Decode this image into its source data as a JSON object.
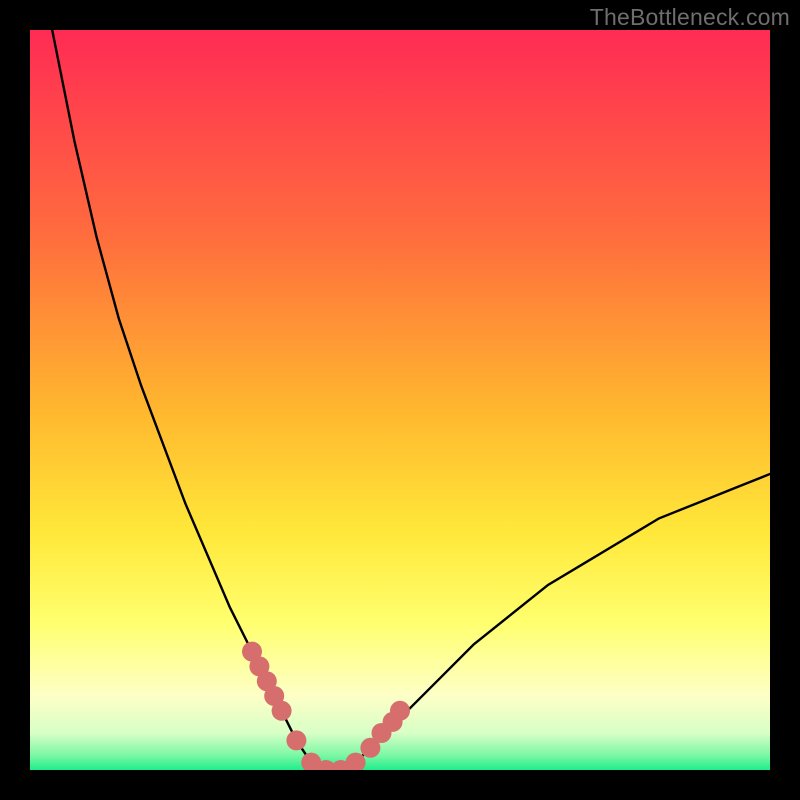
{
  "watermark": "TheBottleneck.com",
  "colors": {
    "frame": "#000000",
    "gradient_top": "#ff2b54",
    "gradient_mid1": "#ff7a3a",
    "gradient_mid2": "#ffd42a",
    "gradient_mid3": "#ffff6a",
    "gradient_mid4": "#fcffcd",
    "gradient_bottom": "#21ef8e",
    "curve": "#000000",
    "marker": "#d66e6e"
  },
  "chart_data": {
    "type": "line",
    "title": "",
    "xlabel": "",
    "ylabel": "",
    "xlim": [
      0,
      100
    ],
    "ylim": [
      0,
      100
    ],
    "legend": false,
    "grid": false,
    "annotations": [
      "TheBottleneck.com"
    ],
    "series": [
      {
        "name": "bottleneck-curve",
        "x": [
          0,
          3,
          6,
          9,
          12,
          15,
          18,
          21,
          24,
          27,
          30,
          32,
          34,
          36,
          38,
          40,
          42,
          44,
          46,
          50,
          55,
          60,
          65,
          70,
          75,
          80,
          85,
          90,
          95,
          100
        ],
        "values": [
          120,
          100,
          85,
          72,
          61,
          52,
          44,
          36,
          29,
          22,
          16,
          12,
          8,
          4,
          1,
          0,
          0,
          1,
          3,
          7,
          12,
          17,
          21,
          25,
          28,
          31,
          34,
          36,
          38,
          40
        ]
      }
    ],
    "marker_ranges": [
      {
        "x_start": 30,
        "x_end": 35
      },
      {
        "x_start": 45,
        "x_end": 49
      }
    ],
    "marker_points": [
      {
        "x": 30,
        "y": 16
      },
      {
        "x": 31,
        "y": 14
      },
      {
        "x": 32,
        "y": 12
      },
      {
        "x": 33,
        "y": 10
      },
      {
        "x": 34,
        "y": 8
      },
      {
        "x": 36,
        "y": 4
      },
      {
        "x": 38,
        "y": 1
      },
      {
        "x": 40,
        "y": 0
      },
      {
        "x": 42,
        "y": 0
      },
      {
        "x": 44,
        "y": 1
      },
      {
        "x": 46,
        "y": 3
      },
      {
        "x": 47.5,
        "y": 5
      },
      {
        "x": 49,
        "y": 6.5
      },
      {
        "x": 50,
        "y": 8
      }
    ]
  }
}
